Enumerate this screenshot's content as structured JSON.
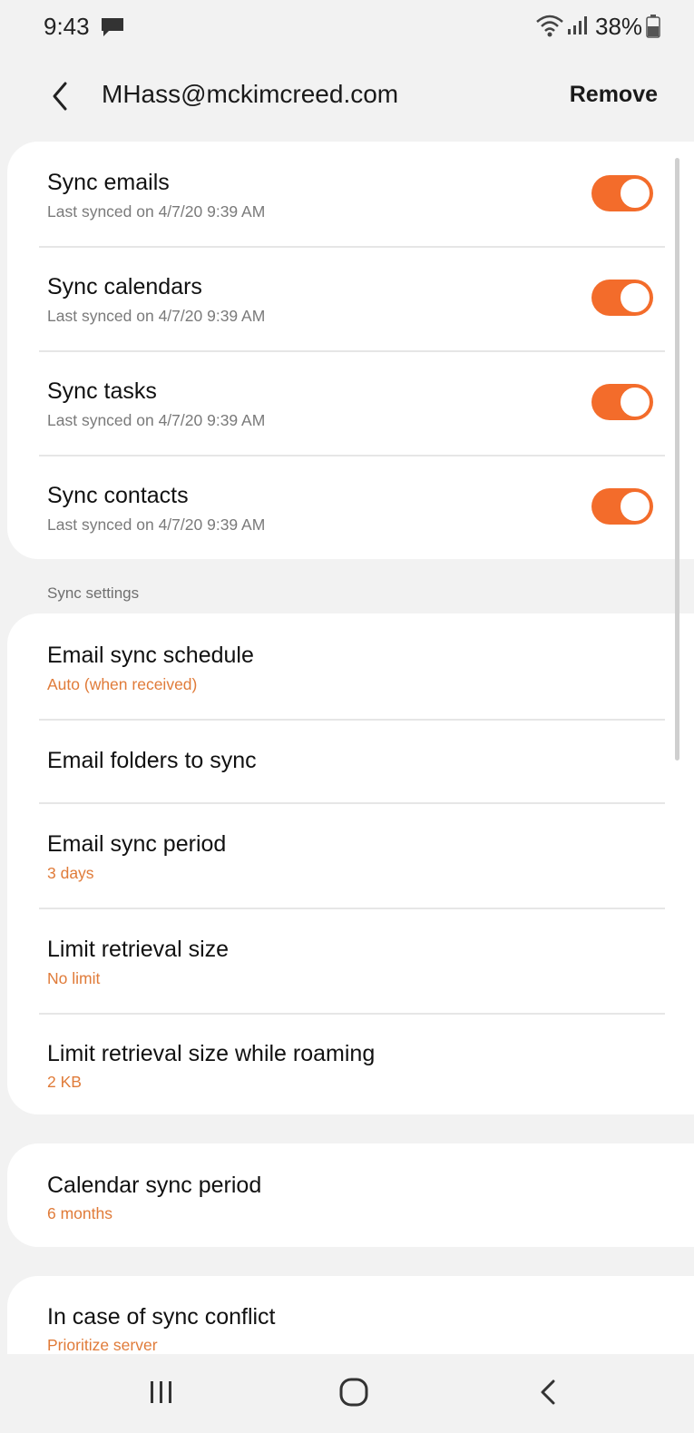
{
  "status_bar": {
    "time": "9:43",
    "battery": "38%",
    "icons": [
      "message-icon",
      "wifi-icon",
      "signal-icon",
      "battery-icon"
    ]
  },
  "app_bar": {
    "title": "MHass@mckimcreed.com",
    "remove_label": "Remove"
  },
  "sync_toggles": [
    {
      "title": "Sync emails",
      "subtitle": "Last synced on 4/7/20  9:39 AM",
      "enabled": true
    },
    {
      "title": "Sync calendars",
      "subtitle": "Last synced on 4/7/20  9:39 AM",
      "enabled": true
    },
    {
      "title": "Sync tasks",
      "subtitle": "Last synced on 4/7/20  9:39 AM",
      "enabled": true
    },
    {
      "title": "Sync contacts",
      "subtitle": "Last synced on 4/7/20  9:39 AM",
      "enabled": true
    }
  ],
  "sync_settings": {
    "label": "Sync settings",
    "items": [
      {
        "title": "Email sync schedule",
        "value": "Auto (when received)"
      },
      {
        "title": "Email folders to sync",
        "value": ""
      },
      {
        "title": "Email sync period",
        "value": "3 days"
      },
      {
        "title": "Limit retrieval size",
        "value": "No limit"
      },
      {
        "title": "Limit retrieval size while roaming",
        "value": "2 KB"
      }
    ]
  },
  "calendar": {
    "title": "Calendar sync period",
    "value": "6 months"
  },
  "conflict": {
    "title": "In case of sync conflict",
    "value": "Prioritize server"
  },
  "colors": {
    "accent": "#f36c2b",
    "value_text": "#e07b39",
    "background": "#f2f2f2"
  }
}
